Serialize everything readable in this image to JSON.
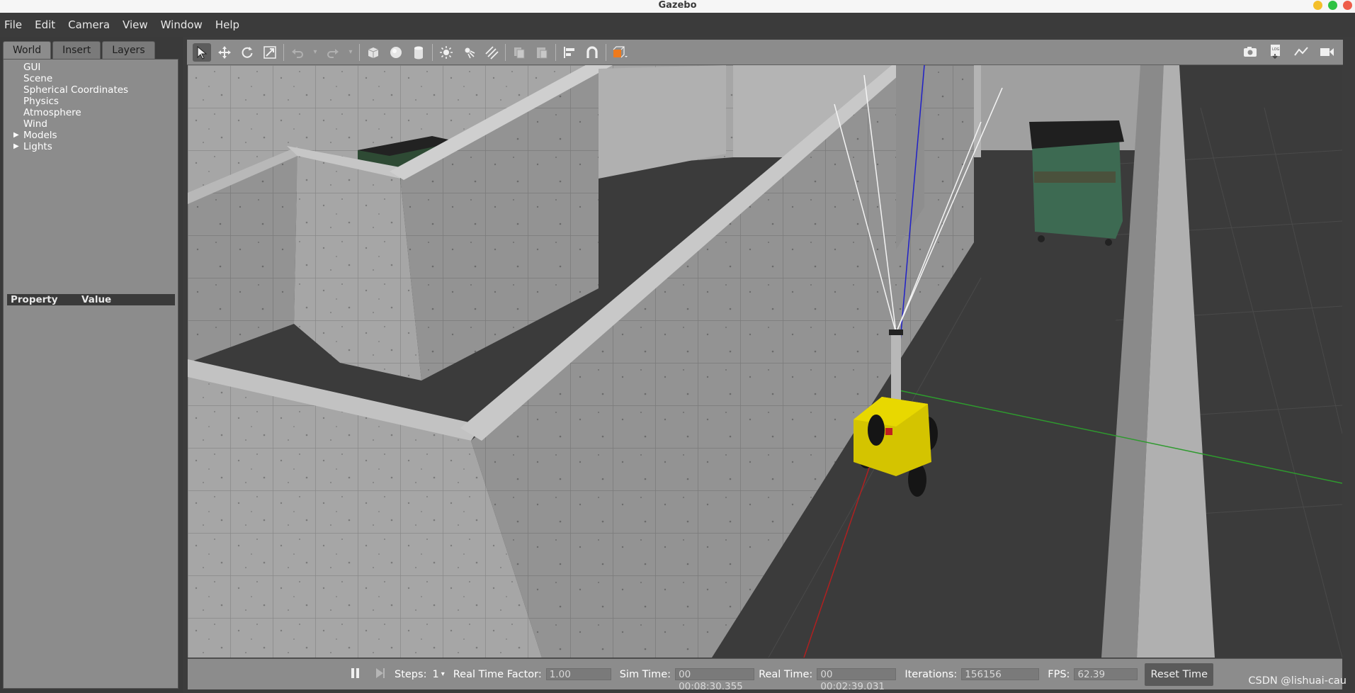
{
  "window": {
    "title": "Gazebo"
  },
  "menu": [
    "File",
    "Edit",
    "Camera",
    "View",
    "Window",
    "Help"
  ],
  "left_panel": {
    "tabs": [
      "World",
      "Insert",
      "Layers"
    ],
    "active_tab": "World",
    "tree": [
      "GUI",
      "Scene",
      "Spherical Coordinates",
      "Physics",
      "Atmosphere",
      "Wind",
      "Models",
      "Lights"
    ],
    "expandable": [
      "Models",
      "Lights"
    ],
    "property_header": {
      "property": "Property",
      "value": "Value"
    }
  },
  "toolbar": {
    "tools": [
      "select-mode",
      "translate-mode",
      "rotate-mode",
      "scale-mode",
      "undo",
      "redo",
      "box-shape",
      "sphere-shape",
      "cylinder-shape",
      "point-light",
      "spot-light",
      "directional-light",
      "copy",
      "paste",
      "align",
      "snap",
      "view-angle"
    ],
    "right_tools": [
      "screenshot",
      "log",
      "plot",
      "record-video"
    ]
  },
  "status": {
    "steps_label": "Steps:",
    "steps_value": "1",
    "rtf_label": "Real Time Factor:",
    "rtf_value": "1.00",
    "sim_time_label": "Sim Time:",
    "sim_time_value": "00 00:08:30.355",
    "real_time_label": "Real Time:",
    "real_time_value": "00 00:02:39.031",
    "iterations_label": "Iterations:",
    "iterations_value": "156156",
    "fps_label": "FPS:",
    "fps_value": "62.39",
    "reset_label": "Reset Time"
  },
  "watermark": "CSDN @lishuai-cau",
  "colors": {
    "robot": "#d4c400",
    "x_axis": "#b02020",
    "y_axis": "#2e9a2e",
    "z_axis": "#2020c8",
    "ground": "#3b3b3b",
    "wall": "#9a9a9a"
  }
}
